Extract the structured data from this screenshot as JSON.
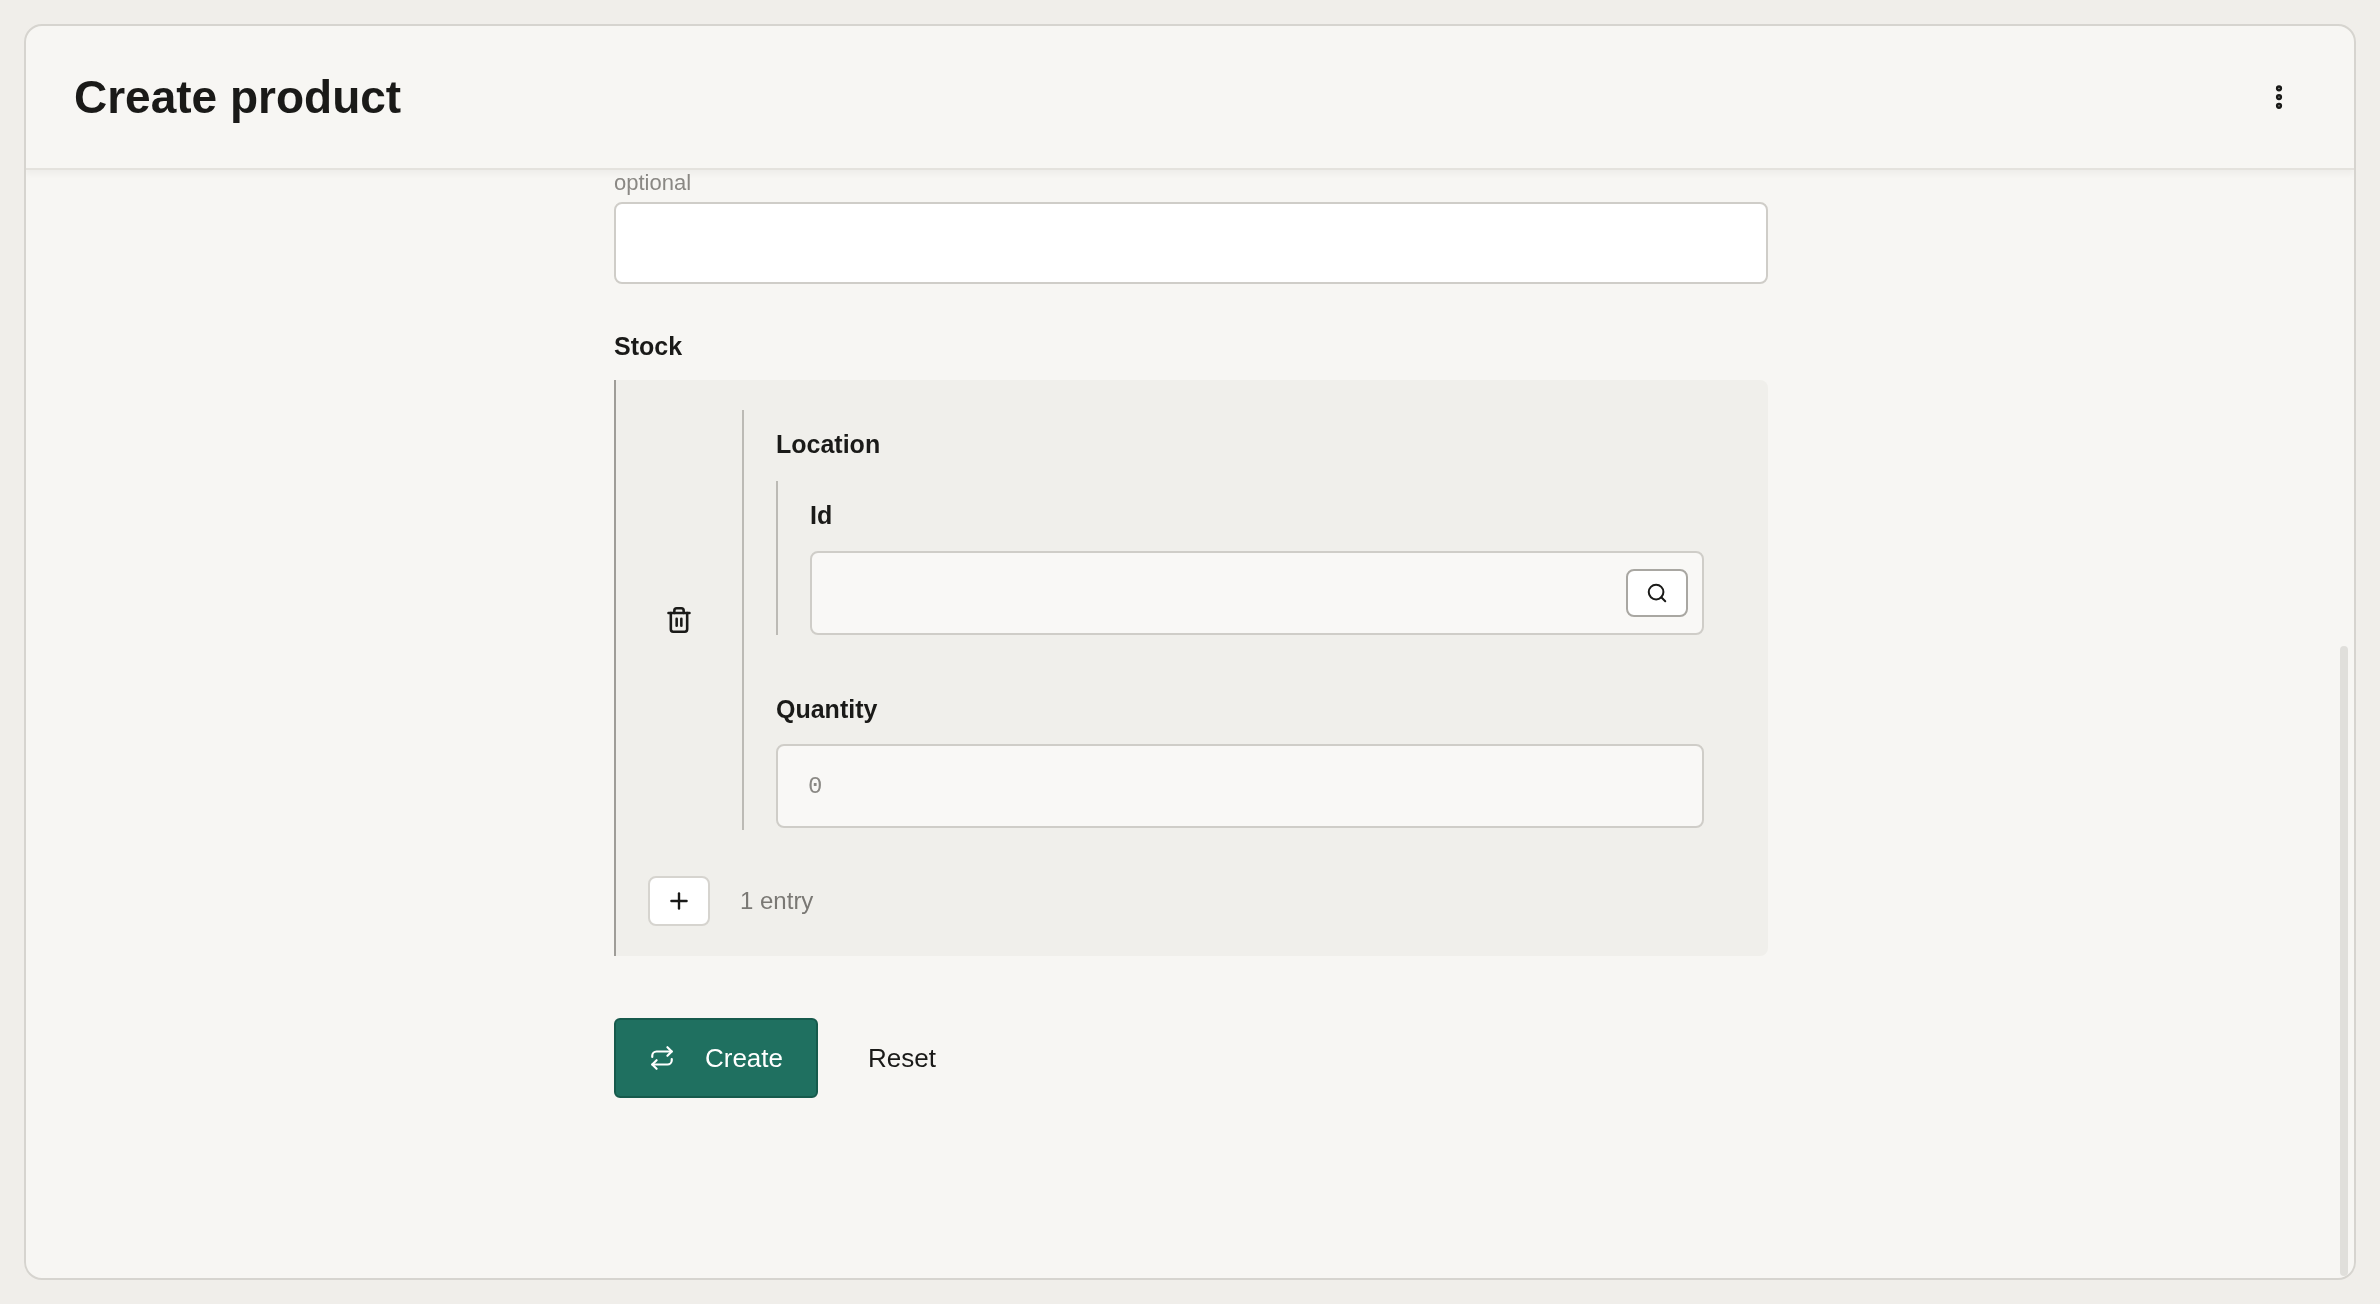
{
  "header": {
    "title": "Create product"
  },
  "optional_field": {
    "label": "optional"
  },
  "stock": {
    "label": "Stock",
    "entries": [
      {
        "location": {
          "label": "Location",
          "id": {
            "label": "Id"
          }
        },
        "quantity": {
          "label": "Quantity",
          "placeholder": "0"
        }
      }
    ],
    "count": "1 entry"
  },
  "actions": {
    "submit": "Create",
    "reset": "Reset"
  }
}
